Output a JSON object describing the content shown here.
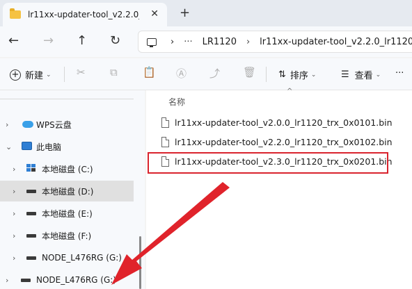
{
  "tab": {
    "title": "lr11xx-updater-tool_v2.2.0_lr112",
    "close_glyph": "✕",
    "new_tab_glyph": "+"
  },
  "nav": {
    "back": "←",
    "forward": "→",
    "up": "↑",
    "refresh": "↻",
    "breadcrumb": [
      "LR1120",
      "lr11xx-updater-tool_v2.2.0_lr1120"
    ],
    "ellipsis": "···",
    "separator": "›"
  },
  "toolbar": {
    "new_label": "新建",
    "sort_label": "排序",
    "view_label": "查看",
    "more": "···"
  },
  "sidebar": {
    "items": [
      {
        "label": "WPS云盘",
        "icon": "cloud-icon"
      },
      {
        "label": "此电脑",
        "icon": "this-pc-icon"
      },
      {
        "label": "本地磁盘 (C:)",
        "icon": "drive-c-icon"
      },
      {
        "label": "本地磁盘 (D:)",
        "icon": "drive-icon"
      },
      {
        "label": "本地磁盘 (E:)",
        "icon": "drive-icon"
      },
      {
        "label": "本地磁盘 (F:)",
        "icon": "drive-icon"
      },
      {
        "label": "NODE_L476RG (G:)",
        "icon": "drive-icon"
      },
      {
        "label": "NODE_L476RG (G:)",
        "icon": "drive-icon"
      }
    ]
  },
  "content": {
    "column_name": "名称",
    "files": [
      "lr11xx-updater-tool_v2.0.0_lr1120_trx_0x0101.bin",
      "lr11xx-updater-tool_v2.2.0_lr1120_trx_0x0102.bin",
      "lr11xx-updater-tool_v2.3.0_lr1120_trx_0x0201.bin"
    ]
  },
  "colors": {
    "highlight": "#d9232d",
    "arrow": "#e0232b",
    "folder": "#f5c242"
  }
}
